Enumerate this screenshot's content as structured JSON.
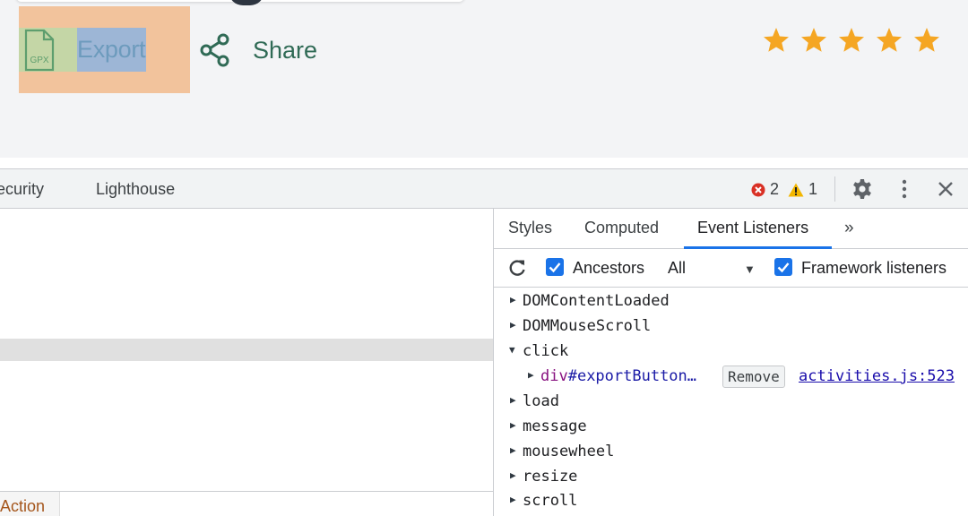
{
  "page": {
    "export_label": "Export",
    "gpx_icon_text": "GPX",
    "share_label": "Share",
    "rating_stars": 5,
    "star_color": "#f5a623"
  },
  "devtools": {
    "tabs": [
      "ecurity",
      "Lighthouse"
    ],
    "errors_count": "2",
    "warnings_count": "1",
    "error_color": "#d93025",
    "warning_color": "#f2b600"
  },
  "left_pane": {
    "bottom_tab_label": "Action"
  },
  "sidebar": {
    "tabs": [
      "Styles",
      "Computed",
      "Event Listeners",
      "»"
    ],
    "active_tab": "Event Listeners",
    "toolbar": {
      "ancestors_label": "Ancestors",
      "ancestors_checked": true,
      "filter_value": "All",
      "filter_arrow": "▼",
      "framework_label": "Framework listeners",
      "framework_checked": true
    },
    "listeners": [
      {
        "event": "DOMContentLoaded",
        "expanded": false
      },
      {
        "event": "DOMMouseScroll",
        "expanded": false
      },
      {
        "event": "click",
        "expanded": true
      },
      {
        "event": "load",
        "expanded": false
      },
      {
        "event": "message",
        "expanded": false
      },
      {
        "event": "mousewheel",
        "expanded": false
      },
      {
        "event": "resize",
        "expanded": false
      },
      {
        "event": "scroll",
        "expanded": false
      }
    ],
    "click_handler": {
      "node_tag": "div",
      "node_id": "#exportButton…",
      "remove_label": "Remove",
      "source": "activities.js:523"
    },
    "accent_color": "#1a73e8"
  }
}
